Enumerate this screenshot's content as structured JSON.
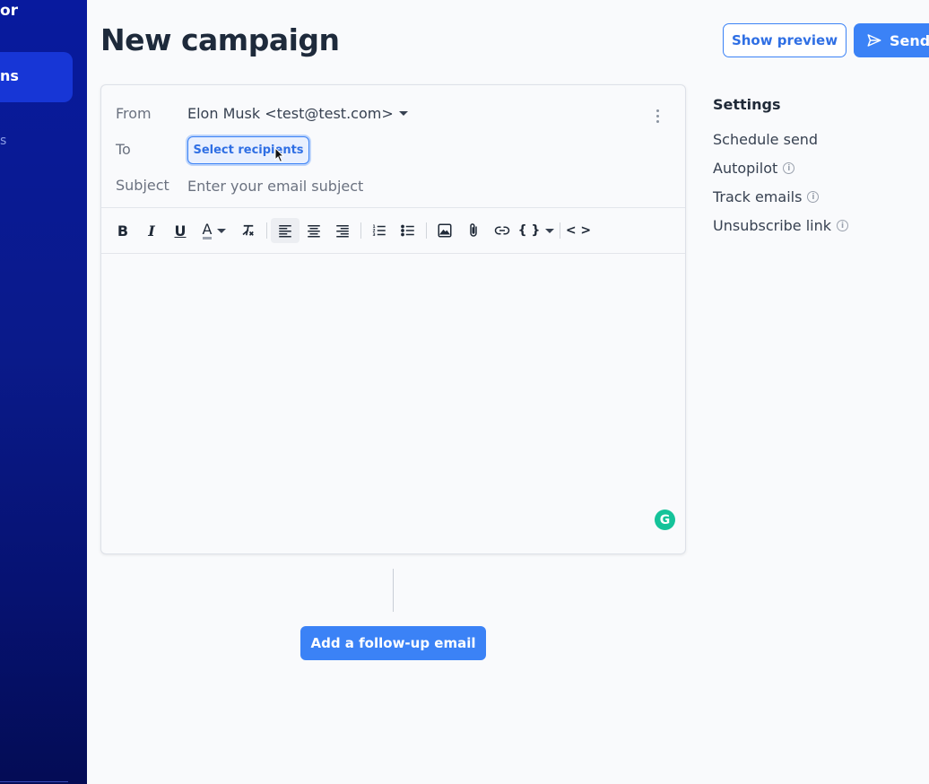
{
  "sidebar": {
    "brand_fragment": "or",
    "active_item_fragment": "ns",
    "item2_fragment": "s"
  },
  "header": {
    "title": "New campaign",
    "show_preview_label": "Show preview",
    "send_label": "Send"
  },
  "composer": {
    "from_label": "From",
    "from_value": "Elon Musk <test@test.com>",
    "to_label": "To",
    "select_recipients_label": "Select recipients",
    "subject_label": "Subject",
    "subject_placeholder": "Enter your email subject",
    "subject_value": "",
    "toolbar": {
      "bold": "B",
      "italic": "I",
      "underline": "U",
      "text_color": "A",
      "variables": "{ }",
      "code": "< >"
    }
  },
  "followup": {
    "add_label": "Add a follow-up email"
  },
  "settings": {
    "title": "Settings",
    "items": [
      {
        "label": "Schedule send",
        "info": false
      },
      {
        "label": "Autopilot",
        "info": true
      },
      {
        "label": "Track emails",
        "info": true
      },
      {
        "label": "Unsubscribe link",
        "info": true
      }
    ]
  },
  "colors": {
    "accent": "#3b82f6",
    "sidebar": "#081a9e",
    "grammarly": "#15c39a"
  }
}
